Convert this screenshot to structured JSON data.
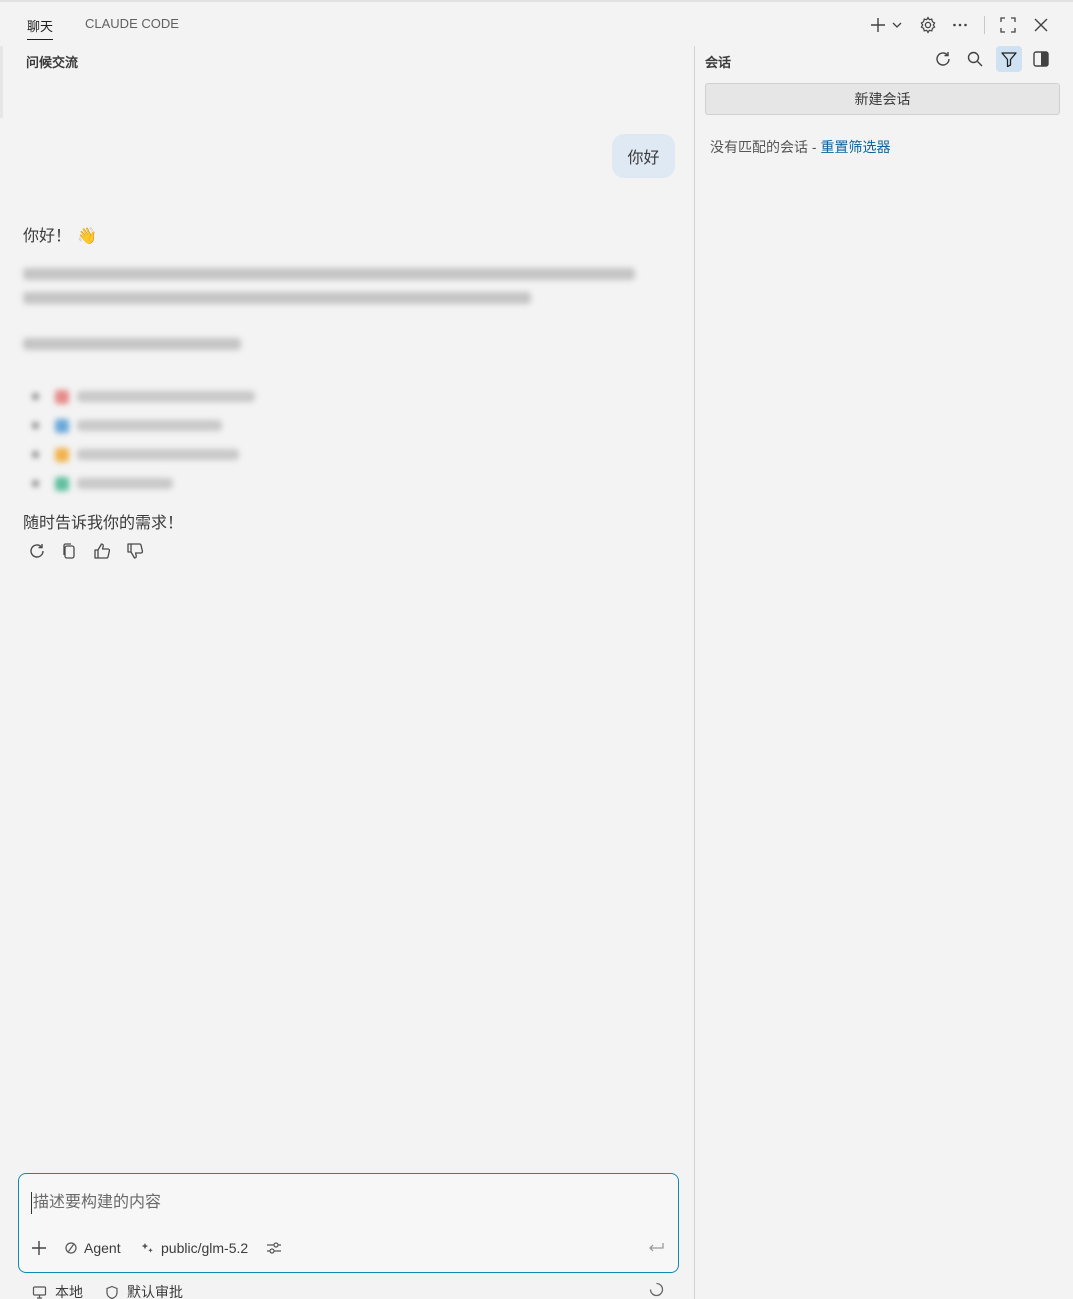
{
  "header": {
    "tabs": [
      {
        "label": "聊天",
        "active": true
      },
      {
        "label": "CLAUDE CODE",
        "active": false
      }
    ]
  },
  "chat": {
    "title": "问候交流",
    "user_message": "你好",
    "ai_greeting": "你好！",
    "ai_greeting_emoji": "👋",
    "ai_closing": "随时告诉我你的需求！"
  },
  "input": {
    "placeholder": "描述要构建的内容",
    "value": "",
    "mode_label": "Agent",
    "model_label": "public/glm-5.2"
  },
  "status_bar": {
    "local_label": "本地",
    "approval_label": "默认审批"
  },
  "sessions": {
    "title": "会话",
    "new_session_label": "新建会话",
    "no_match_text": "没有匹配的会话 - ",
    "reset_filter_link": "重置筛选器"
  },
  "colors": {
    "accent": "#0e8ab8",
    "link": "#0e639c",
    "user_bubble": "#dfe9f4",
    "active_icon_bg": "#cfe2f3"
  },
  "icons": [
    "plus-icon",
    "chevron-down-icon",
    "gear-icon",
    "more-icon",
    "maximize-icon",
    "close-icon",
    "refresh-icon",
    "search-icon",
    "filter-icon",
    "panel-icon",
    "copy-icon",
    "thumbs-up-icon",
    "thumbs-down-icon",
    "agent-icon",
    "model-icon",
    "settings-sliders-icon",
    "enter-icon",
    "monitor-icon",
    "shield-icon",
    "spinner-icon"
  ]
}
